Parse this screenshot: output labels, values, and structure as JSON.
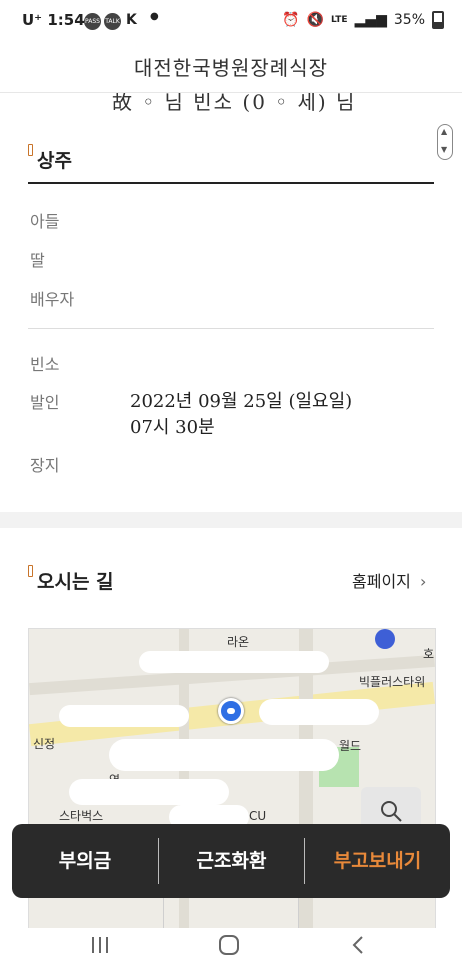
{
  "status_bar": {
    "carrier": "U⁺",
    "time": "1:54",
    "app_badges": [
      "PASS",
      "TALK"
    ],
    "network": "LTE",
    "battery": "35%"
  },
  "header": {
    "title": "대전한국병원장례식장"
  },
  "partial_text": "故 ◦ 님 빈소 (0 ◦ 세) 님",
  "mourners": {
    "title": "상주",
    "rows": [
      {
        "label": "아들"
      },
      {
        "label": "딸"
      },
      {
        "label": "배우자"
      }
    ]
  },
  "details": {
    "rows": [
      {
        "label": "빈소",
        "value": ""
      },
      {
        "label": "발인",
        "value_line1": "2022년 09월 25일 (일요일)",
        "value_line2": "07시 30분"
      },
      {
        "label": "장지",
        "value": ""
      }
    ]
  },
  "directions": {
    "title": "오시는 길",
    "homepage_link": "홈페이지",
    "map_labels": [
      "라온",
      "호",
      "빅플러스타워",
      "신정",
      "역",
      "월드",
      "스타벅스",
      "CU"
    ]
  },
  "action_bar": {
    "buttons": [
      "부의금",
      "근조화환",
      "부고보내기"
    ],
    "accent_color": "#e8893a"
  },
  "nav_bar": {
    "icons": [
      "recent-apps-icon",
      "home-icon",
      "back-icon"
    ]
  }
}
